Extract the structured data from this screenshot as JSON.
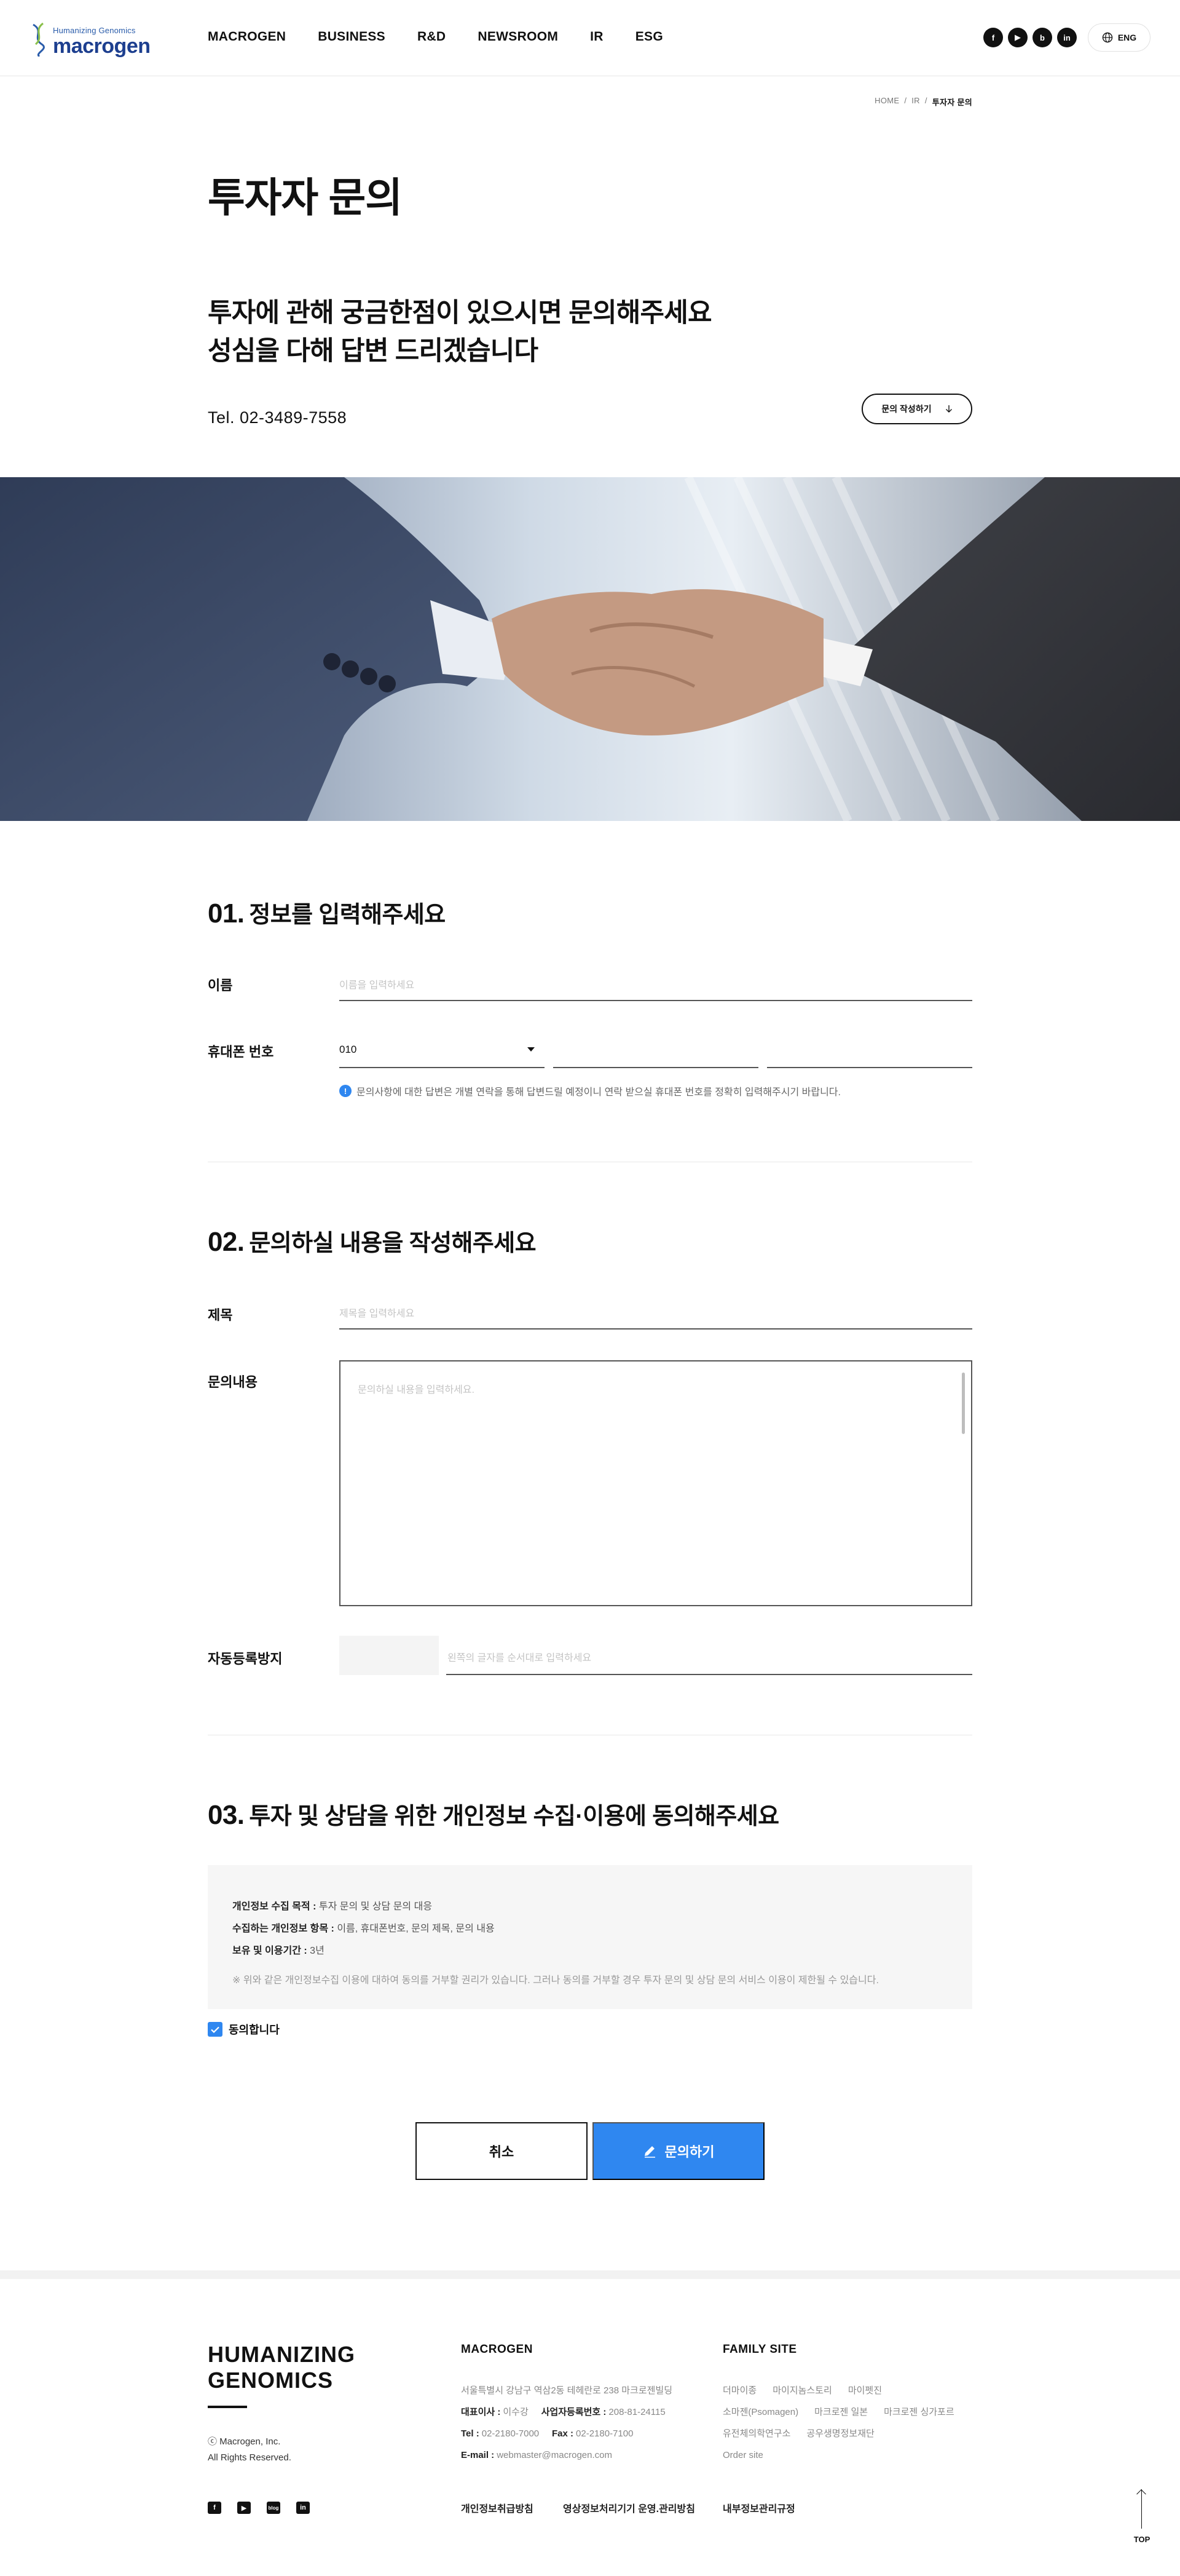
{
  "header": {
    "logo_tagline": "Humanizing Genomics",
    "logo_word": "macrogen",
    "nav": [
      "MACROGEN",
      "BUSINESS",
      "R&D",
      "NEWSROOM",
      "IR",
      "ESG"
    ],
    "sns": [
      "f",
      "▶",
      "b",
      "in"
    ],
    "lang_label": "ENG"
  },
  "breadcrumb": [
    "HOME",
    "IR",
    "투자자 문의"
  ],
  "page_title": "투자자 문의",
  "lead": {
    "line1": "투자에 관해 궁금한점이 있으시면 문의해주세요",
    "line2": "성심을 다해 답변 드리겠습니다"
  },
  "tel": "Tel. 02-3489-7558",
  "inquiry_button": "문의 작성하기",
  "section1": {
    "num": "01.",
    "title": "정보를 입력해주세요",
    "name_label": "이름",
    "name_placeholder": "이름을 입력하세요",
    "phone_label": "휴대폰 번호",
    "phone_prefix": "010",
    "notice": "문의사항에 대한 답변은 개별 연락을 통해 답변드릴 예정이니 연락 받으실 휴대폰 번호를 정확히 입력해주시기 바랍니다."
  },
  "section2": {
    "num": "02.",
    "title": "문의하실 내용을 작성해주세요",
    "subject_label": "제목",
    "subject_placeholder": "제목을 입력하세요",
    "content_label": "문의내용",
    "content_placeholder": "문의하실 내용을 입력하세요.",
    "captcha_label": "자동등록방지",
    "captcha_placeholder": "왼쪽의 글자를 순서대로 입력하세요"
  },
  "section3": {
    "num": "03.",
    "title": "투자 및 상담을 위한 개인정보 수집·이용에 동의해주세요",
    "purpose_label": "개인정보 수집 목적 :",
    "purpose_value": "투자 문의 및 상담 문의 대응",
    "items_label": "수집하는 개인정보 항목 :",
    "items_value": "이름, 휴대폰번호, 문의 제목, 문의 내용",
    "period_label": "보유 및 이용기간 :",
    "period_value": "3년",
    "note": "※ 위와 같은 개인정보수집 이용에 대하여 동의를 거부할 권리가 있습니다. 그러나 동의를 거부할 경우 투자 문의 및 상담 문의 서비스 이용이 제한될 수 있습니다.",
    "agree_label": "동의합니다"
  },
  "buttons": {
    "cancel": "취소",
    "submit": "문의하기"
  },
  "footer": {
    "slogan_line1": "HUMANIZING",
    "slogan_line2": "GENOMICS",
    "copy_line1": "ⓒ Macrogen, Inc.",
    "copy_line2": "All Rights Reserved.",
    "macrogen_title": "MACROGEN",
    "address": "서울특별시 강남구 역삼2동 테헤란로 238 마크로젠빌딩",
    "ceo_label": "대표이사 :",
    "ceo_value": "이수강",
    "biz_label": "사업자등록번호 :",
    "biz_value": "208-81-24115",
    "tel_label": "Tel :",
    "tel_value": "02-2180-7000",
    "fax_label": "Fax :",
    "fax_value": "02-2180-7100",
    "email_label": "E-mail :",
    "email_value": "webmaster@macrogen.com",
    "family_title": "FAMILY SITE",
    "family_sites": [
      "더마이종",
      "마이지놈스토리",
      "마이펫진",
      "소마젠(Psomagen)",
      "마크로젠 일본",
      "마크로젠 싱가포르",
      "유전체의학연구소",
      "공우생명정보재단",
      "Order site"
    ],
    "links": [
      "개인정보취급방침",
      "영상정보처리기기 운영.관리방침",
      "내부정보관리규정"
    ],
    "sns": [
      "f",
      "▶",
      "blog",
      "in"
    ],
    "top_label": "TOP"
  },
  "colors": {
    "accent": "#2f87f0",
    "brand": "#1d3f8f"
  }
}
